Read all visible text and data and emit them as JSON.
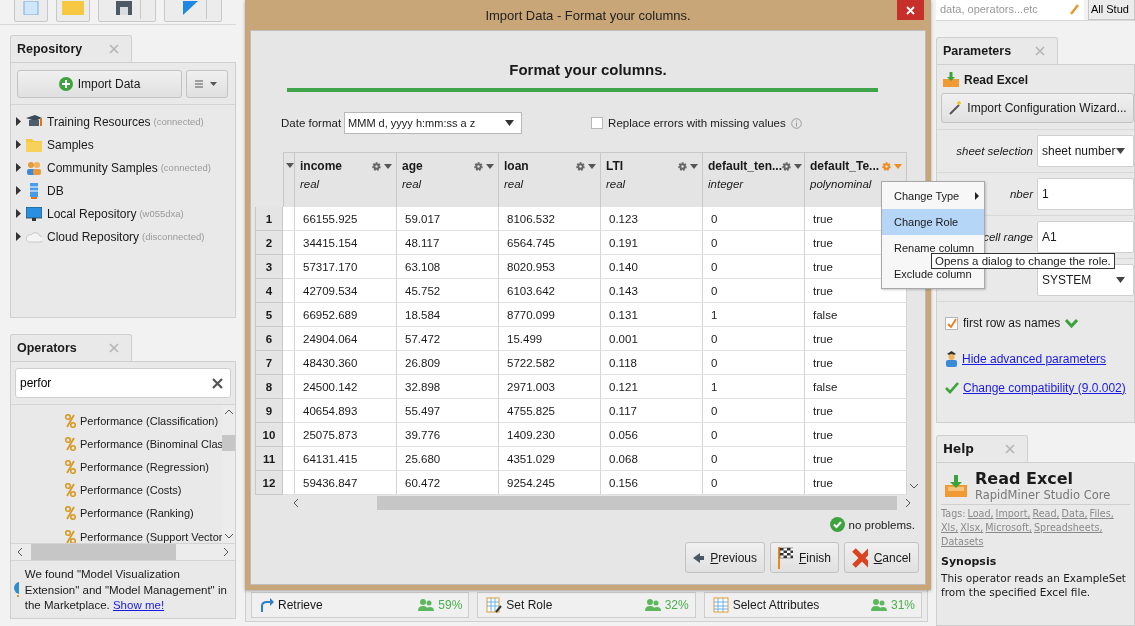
{
  "top_bar": {
    "search_placeholder": "data, operators...etc",
    "scope_button": "All Stud"
  },
  "repository": {
    "tab": "Repository",
    "import_button": "Import Data",
    "items": [
      {
        "name": "Training Resources",
        "note": "(connected)"
      },
      {
        "name": "Samples"
      },
      {
        "name": "Community Samples",
        "note": "(connected)"
      },
      {
        "name": "DB"
      },
      {
        "name": "Local Repository",
        "note": "(w055dxa)"
      },
      {
        "name": "Cloud Repository",
        "note": "(disconnected)"
      }
    ]
  },
  "operators": {
    "tab": "Operators",
    "search": {
      "value": "perfor"
    },
    "items": [
      "Performance (Classification)",
      "Performance (Binominal Clas",
      "Performance (Regression)",
      "Performance (Costs)",
      "Performance (Ranking)",
      "Performance (Support Vector"
    ],
    "notice": {
      "text": "We found \"Model Visualization Extension\" and \"Model Management\" in the Marketplace.",
      "link": "Show me!"
    }
  },
  "dialog": {
    "title": "Import Data - Format your columns.",
    "heading": "Format your columns.",
    "date_format": {
      "label": "Date format",
      "value": "MMM d, yyyy h:mm:ss a z"
    },
    "replace_errors": {
      "label": "Replace errors with missing values",
      "checked": false
    },
    "columns": [
      {
        "name": "income",
        "type": "real",
        "menu_open": false
      },
      {
        "name": "age",
        "type": "real",
        "menu_open": false
      },
      {
        "name": "loan",
        "type": "real",
        "menu_open": false
      },
      {
        "name": "LTI",
        "type": "real",
        "menu_open": false
      },
      {
        "name": "default_ten...",
        "type": "integer",
        "menu_open": false
      },
      {
        "name": "default_Te...",
        "type": "polynominal",
        "menu_open": true
      }
    ],
    "rows": [
      {
        "index": "1",
        "cells": [
          "66155.925",
          "59.017",
          "8106.532",
          "0.123",
          "0",
          "true"
        ]
      },
      {
        "index": "2",
        "cells": [
          "34415.154",
          "48.117",
          "6564.745",
          "0.191",
          "0",
          "true"
        ]
      },
      {
        "index": "3",
        "cells": [
          "57317.170",
          "63.108",
          "8020.953",
          "0.140",
          "0",
          "true"
        ]
      },
      {
        "index": "4",
        "cells": [
          "42709.534",
          "45.752",
          "6103.642",
          "0.143",
          "0",
          "true"
        ]
      },
      {
        "index": "5",
        "cells": [
          "66952.689",
          "18.584",
          "8770.099",
          "0.131",
          "1",
          "false"
        ]
      },
      {
        "index": "6",
        "cells": [
          "24904.064",
          "57.472",
          "15.499",
          "0.001",
          "0",
          "true"
        ]
      },
      {
        "index": "7",
        "cells": [
          "48430.360",
          "26.809",
          "5722.582",
          "0.118",
          "0",
          "true"
        ]
      },
      {
        "index": "8",
        "cells": [
          "24500.142",
          "32.898",
          "2971.003",
          "0.121",
          "1",
          "false"
        ]
      },
      {
        "index": "9",
        "cells": [
          "40654.893",
          "55.497",
          "4755.825",
          "0.117",
          "0",
          "true"
        ]
      },
      {
        "index": "10",
        "cells": [
          "25075.873",
          "39.776",
          "1409.230",
          "0.056",
          "0",
          "true"
        ]
      },
      {
        "index": "11",
        "cells": [
          "64131.415",
          "25.680",
          "4351.029",
          "0.068",
          "0",
          "true"
        ]
      },
      {
        "index": "12",
        "cells": [
          "59436.847",
          "60.472",
          "9254.245",
          "0.156",
          "0",
          "true"
        ]
      }
    ],
    "status": "no problems.",
    "buttons": [
      {
        "kind": "previous",
        "label": "Previous"
      },
      {
        "kind": "finish",
        "label": "Finish"
      },
      {
        "kind": "cancel",
        "label": "Cancel"
      }
    ],
    "context_menu": [
      {
        "label": "Change Type",
        "submenu": true,
        "selected": false
      },
      {
        "label": "Change Role",
        "submenu": false,
        "selected": true
      },
      {
        "label": "Rename column",
        "submenu": false,
        "selected": false
      },
      {
        "label": "Exclude column",
        "submenu": false,
        "selected": false
      }
    ],
    "tooltip": "Opens a dialog to change the role."
  },
  "suggestions": [
    {
      "label": "Retrieve",
      "share": "59%"
    },
    {
      "label": "Set Role",
      "share": "32%"
    },
    {
      "label": "Select Attributes",
      "share": "31%"
    }
  ],
  "parameters": {
    "tab": "Parameters",
    "operator": "Read Excel",
    "wizard_button": "Import Configuration Wizard...",
    "fields": [
      {
        "kind": "select",
        "label": "sheet selection",
        "value": "sheet number"
      },
      {
        "kind": "text",
        "label": "nber",
        "value": "1"
      },
      {
        "kind": "text",
        "label": "cell range",
        "value": "A1"
      },
      {
        "kind": "select",
        "value": "SYSTEM"
      }
    ],
    "first_row_as_names": {
      "label": "first row as names",
      "checked": true
    },
    "links": [
      "Hide advanced parameters",
      "Change compatibility (9.0.002)"
    ]
  },
  "help": {
    "tab": "Help",
    "title": "Read Excel",
    "subtitle": "RapidMiner Studio Core",
    "tags_label": "Tags:",
    "tags": [
      "Load,",
      "Import,",
      "Read,",
      "Data,",
      "Files,",
      "Xls,",
      "Xlsx,",
      "Microsoft,",
      "Spreadsheets,",
      "Datasets"
    ],
    "synopsis_heading": "Synopsis",
    "synopsis": "This operator reads an ExampleSet from the specified Excel file."
  }
}
